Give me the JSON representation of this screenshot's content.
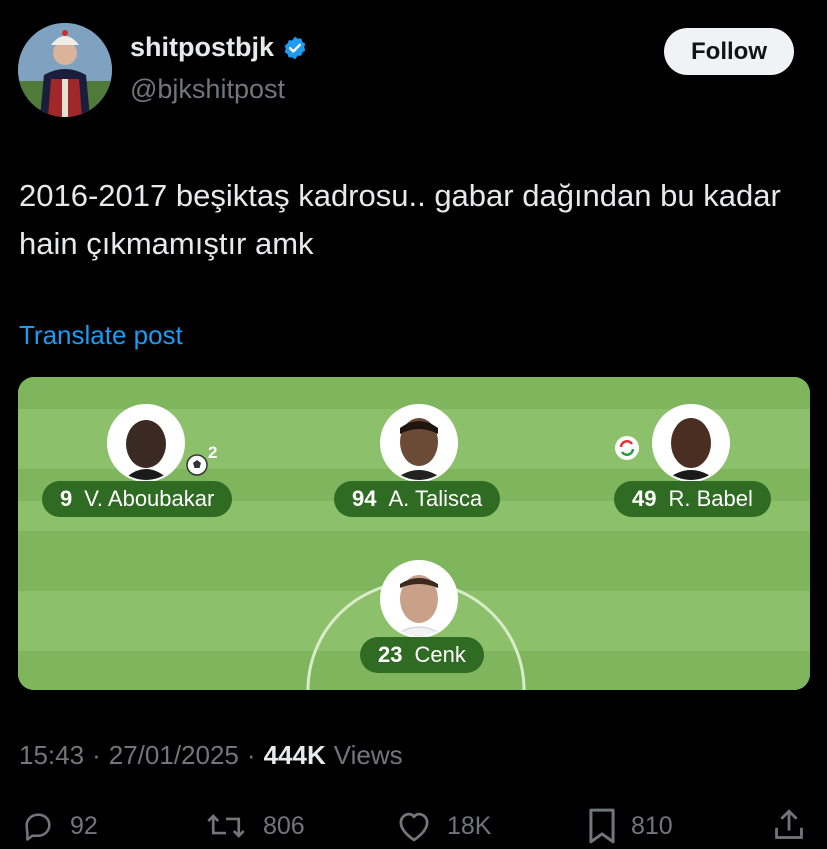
{
  "author": {
    "display_name": "shitpostbjk",
    "handle": "@bjkshitpost",
    "verified": true,
    "avatar_icon": "avatar-portrait-icon"
  },
  "follow_label": "Follow",
  "post": {
    "text": "2016-2017 beşiktaş kadrosu.. gabar dağından bu kadar hain çıkmamıştır amk",
    "translate_label": "Translate post"
  },
  "lineup": {
    "players": [
      {
        "number": "9",
        "name": "V. Aboubakar",
        "badge": "2",
        "badge_icon": "football-icon"
      },
      {
        "number": "94",
        "name": "A. Talisca"
      },
      {
        "number": "49",
        "name": "R. Babel",
        "badge_icon": "substitution-icon"
      },
      {
        "number": "23",
        "name": "Cenk"
      }
    ]
  },
  "meta": {
    "time": "15:43",
    "date": "27/01/2025",
    "views_count": "444K",
    "views_label": "Views"
  },
  "actions": {
    "replies": "92",
    "reposts": "806",
    "likes": "18K",
    "bookmarks": "810"
  },
  "colors": {
    "background": "#000000",
    "text": "#e7e9ea",
    "muted": "#71767b",
    "link": "#1d9bf0",
    "pitch_light": "#8cc06a",
    "pitch_dark": "#7fb55c",
    "nameplate": "#2f6b22",
    "verified": "#1d9bf0"
  }
}
